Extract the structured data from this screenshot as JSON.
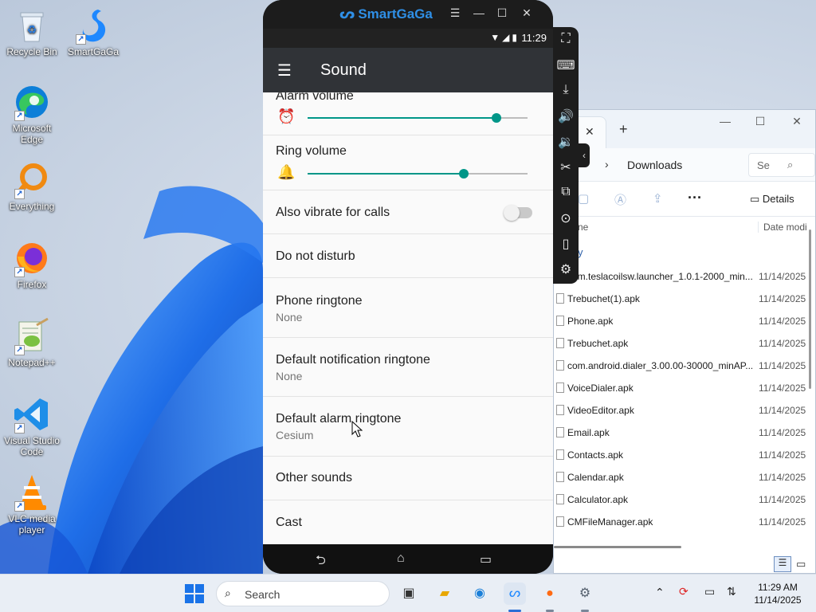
{
  "desktop": {
    "icons": [
      {
        "label": "Recycle Bin",
        "icon": "recycle-bin-icon"
      },
      {
        "label": "SmartGaGa",
        "icon": "smartgaga-icon"
      },
      {
        "label": "Microsoft Edge",
        "icon": "edge-icon"
      },
      {
        "label": "Everything",
        "icon": "everything-search-icon"
      },
      {
        "label": "Firefox",
        "icon": "firefox-icon"
      },
      {
        "label": "Notepad++",
        "icon": "notepadpp-icon"
      },
      {
        "label": "Visual Studio Code",
        "icon": "vscode-icon"
      },
      {
        "label": "VLC media player",
        "icon": "vlc-icon"
      }
    ]
  },
  "emulator": {
    "title": "SmartGaGa",
    "status_time": "11:29",
    "app_title": "Sound",
    "rows": {
      "alarm_volume": {
        "label": "Alarm volume",
        "level": 0.86
      },
      "ring_volume": {
        "label": "Ring volume",
        "level": 0.71
      },
      "vibrate": {
        "label": "Also vibrate for calls",
        "on": false
      },
      "dnd": {
        "label": "Do not disturb"
      },
      "phone_ringtone": {
        "label": "Phone ringtone",
        "value": "None"
      },
      "notif_ringtone": {
        "label": "Default notification ringtone",
        "value": "None"
      },
      "alarm_ringtone": {
        "label": "Default alarm ringtone",
        "value": "Cesium"
      },
      "other_sounds": {
        "label": "Other sounds"
      },
      "cast": {
        "label": "Cast"
      }
    },
    "accent": "#009688"
  },
  "explorer": {
    "path": "Downloads",
    "search_placeholder": "Se",
    "details_label": "Details",
    "col_name": "ne",
    "col_date": "Date modi",
    "group_label": "y",
    "files": [
      {
        "name": "com.teslacoilsw.launcher_1.0.1-2000_min...",
        "date": "11/14/2025"
      },
      {
        "name": "Trebuchet(1).apk",
        "date": "11/14/2025"
      },
      {
        "name": "Phone.apk",
        "date": "11/14/2025"
      },
      {
        "name": "Trebuchet.apk",
        "date": "11/14/2025"
      },
      {
        "name": "com.android.dialer_3.00.00-30000_minAP...",
        "date": "11/14/2025"
      },
      {
        "name": "VoiceDialer.apk",
        "date": "11/14/2025"
      },
      {
        "name": "VideoEditor.apk",
        "date": "11/14/2025"
      },
      {
        "name": "Email.apk",
        "date": "11/14/2025"
      },
      {
        "name": "Contacts.apk",
        "date": "11/14/2025"
      },
      {
        "name": "Calendar.apk",
        "date": "11/14/2025"
      },
      {
        "name": "Calculator.apk",
        "date": "11/14/2025"
      },
      {
        "name": "CMFileManager.apk",
        "date": "11/14/2025"
      }
    ]
  },
  "taskbar": {
    "search_placeholder": "Search",
    "time": "11:29 AM",
    "date": "11/14/2025",
    "apps": [
      "file-manager-icon",
      "file-explorer-icon",
      "edge-icon",
      "smartgaga-icon",
      "firefox-icon",
      "settings-icon"
    ]
  }
}
